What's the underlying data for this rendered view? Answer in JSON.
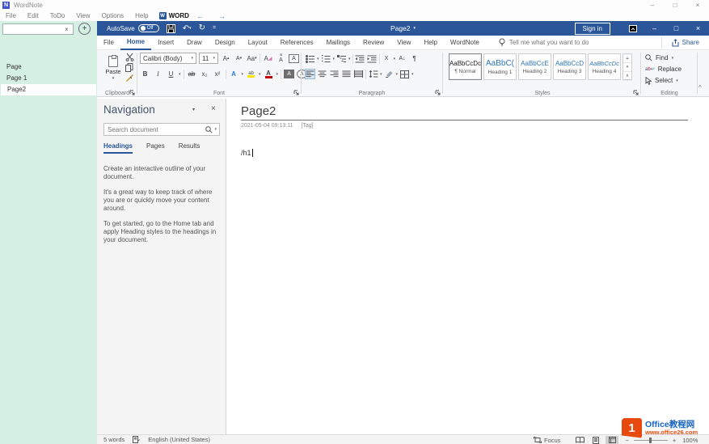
{
  "window": {
    "title": "WordNote"
  },
  "menubar": {
    "items": [
      "File",
      "Edit",
      "ToDo",
      "View",
      "Options",
      "Help"
    ],
    "word_button": "WORD"
  },
  "sidebar": {
    "search_value": "",
    "pages": [
      {
        "label": "Page"
      },
      {
        "label": "Page 1"
      },
      {
        "label": "Page2"
      }
    ],
    "selected_page": "Page2"
  },
  "word_titlebar": {
    "autosave_label": "AutoSave",
    "autosave_state": "Off",
    "doc_title": "Page2",
    "sign_in": "Sign in"
  },
  "ribbon": {
    "tabs": [
      "File",
      "Home",
      "Insert",
      "Draw",
      "Design",
      "Layout",
      "References",
      "Mailings",
      "Review",
      "View",
      "Help",
      "WordNote"
    ],
    "active_tab": "Home",
    "tell_me": "Tell me what you want to do",
    "share": "Share",
    "clipboard": {
      "label": "Clipboard",
      "paste": "Paste"
    },
    "font": {
      "label": "Font",
      "family": "Calibri (Body)",
      "size": "11"
    },
    "paragraph": {
      "label": "Paragraph"
    },
    "styles": {
      "label": "Styles",
      "items": [
        {
          "sample": "AaBbCcDc",
          "name": "¶ Normal"
        },
        {
          "sample": "AaBbC(",
          "name": "Heading 1"
        },
        {
          "sample": "AaBbCcE",
          "name": "Heading 2"
        },
        {
          "sample": "AaBbCcD",
          "name": "Heading 3"
        },
        {
          "sample": "AaBbCcDc",
          "name": "Heading 4"
        }
      ]
    },
    "editing": {
      "label": "Editing",
      "find": "Find",
      "replace": "Replace",
      "select": "Select"
    }
  },
  "navigation": {
    "title": "Navigation",
    "search_placeholder": "Search document",
    "tabs": [
      "Headings",
      "Pages",
      "Results"
    ],
    "active_tab": "Headings",
    "paragraphs": [
      "Create an interactive outline of your document.",
      "It's a great way to keep track of where you are or quickly move your content around.",
      "To get started, go to the Home tab and apply Heading styles to the headings in your document."
    ]
  },
  "document": {
    "title": "Page2",
    "timestamp": "2021-05-04 09:13:11",
    "tag": "[Tag]",
    "body": "/h1"
  },
  "statusbar": {
    "word_count": "5 words",
    "language": "English (United States)",
    "focus": "Focus",
    "zoom_level": "100%"
  },
  "watermark": {
    "brand": "Office教程网",
    "url": "www.office26.com"
  },
  "icons": {
    "close": "×",
    "minimize": "–",
    "maximize": "□",
    "dropdown": "▾",
    "up": "▴",
    "overflow": "⇟",
    "plus": "+",
    "clear": "×",
    "back": "←",
    "forward": "→",
    "undo": "↶",
    "redo": "↻",
    "more": "=",
    "pilcrow": "¶",
    "bold": "B",
    "italic": "I",
    "underline": "U",
    "strikethrough": "ab",
    "grow_font": "A",
    "shrink_font": "A",
    "change_case": "Aa",
    "clear_format": "A",
    "phonetic_top": "a",
    "phonetic": "A",
    "char_border": "A",
    "subscript": "x₂",
    "superscript": "x²",
    "text_effects": "A",
    "highlight_pen": "ab",
    "font_color": "A",
    "char_shading": "A",
    "enclose": "A",
    "asian_layout": "X",
    "sort": "A↓",
    "collapse": "^",
    "minus": "−"
  },
  "colors": {
    "word_blue": "#2b579a",
    "sidebar_green": "#d5efe3",
    "heading_blue": "#2e74b5",
    "accent_orange": "#e8490f",
    "nav_title": "#44546a"
  }
}
